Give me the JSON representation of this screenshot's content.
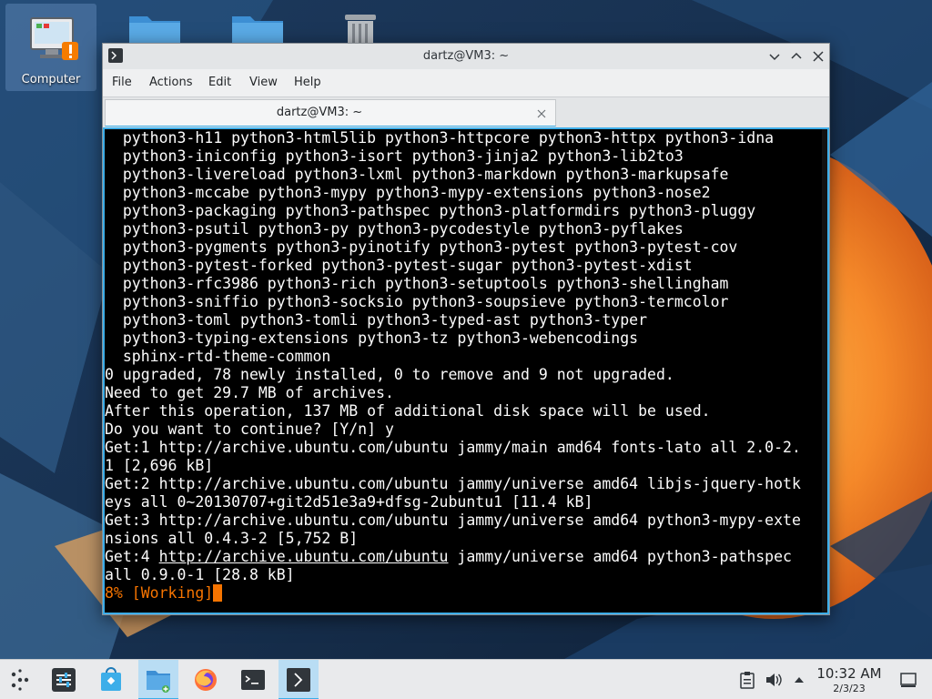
{
  "desktop": {
    "icons": [
      {
        "label": "Computer"
      },
      {
        "label": ""
      },
      {
        "label": ""
      },
      {
        "label": ""
      }
    ]
  },
  "window": {
    "title": "dartz@VM3: ~",
    "menu": [
      "File",
      "Actions",
      "Edit",
      "View",
      "Help"
    ],
    "tab": {
      "label": "dartz@VM3: ~"
    },
    "terminal": {
      "lines": [
        "  python3-h11 python3-html5lib python3-httpcore python3-httpx python3-idna",
        "  python3-iniconfig python3-isort python3-jinja2 python3-lib2to3",
        "  python3-livereload python3-lxml python3-markdown python3-markupsafe",
        "  python3-mccabe python3-mypy python3-mypy-extensions python3-nose2",
        "  python3-packaging python3-pathspec python3-platformdirs python3-pluggy",
        "  python3-psutil python3-py python3-pycodestyle python3-pyflakes",
        "  python3-pygments python3-pyinotify python3-pytest python3-pytest-cov",
        "  python3-pytest-forked python3-pytest-sugar python3-pytest-xdist",
        "  python3-rfc3986 python3-rich python3-setuptools python3-shellingham",
        "  python3-sniffio python3-socksio python3-soupsieve python3-termcolor",
        "  python3-toml python3-tomli python3-typed-ast python3-typer",
        "  python3-typing-extensions python3-tz python3-webencodings",
        "  sphinx-rtd-theme-common",
        "0 upgraded, 78 newly installed, 0 to remove and 9 not upgraded.",
        "Need to get 29.7 MB of archives.",
        "After this operation, 137 MB of additional disk space will be used.",
        "Do you want to continue? [Y/n] y",
        "Get:1 http://archive.ubuntu.com/ubuntu jammy/main amd64 fonts-lato all 2.0-2.",
        "1 [2,696 kB]",
        "Get:2 http://archive.ubuntu.com/ubuntu jammy/universe amd64 libjs-jquery-hotk",
        "eys all 0~20130707+git2d51e3a9+dfsg-2ubuntu1 [11.4 kB]",
        "Get:3 http://archive.ubuntu.com/ubuntu jammy/universe amd64 python3-mypy-exte",
        "nsions all 0.4.3-2 [5,752 B]"
      ],
      "get4_prefix": "Get:4 ",
      "get4_link": "http://archive.ubuntu.com/ubuntu",
      "get4_suffix": " jammy/universe amd64 python3-pathspec",
      "get4_cont": "all 0.9.0-1 [28.8 kB]",
      "status": "8% [Working]"
    }
  },
  "taskbar": {
    "items": [
      {
        "icon": "application-launcher-icon"
      },
      {
        "icon": "system-settings-icon"
      },
      {
        "icon": "discover-store-icon"
      },
      {
        "icon": "dolphin-file-manager-icon"
      },
      {
        "icon": "firefox-icon"
      },
      {
        "icon": "konsole-icon"
      },
      {
        "icon": "konsole-window-icon"
      }
    ],
    "tray": {
      "time": "10:32 AM",
      "date": "2/3/23"
    }
  },
  "colors": {
    "accent": "#3daee9",
    "status_orange": "#f67400",
    "terminal_bg": "#000000",
    "terminal_fg": "#fcfcfc"
  }
}
